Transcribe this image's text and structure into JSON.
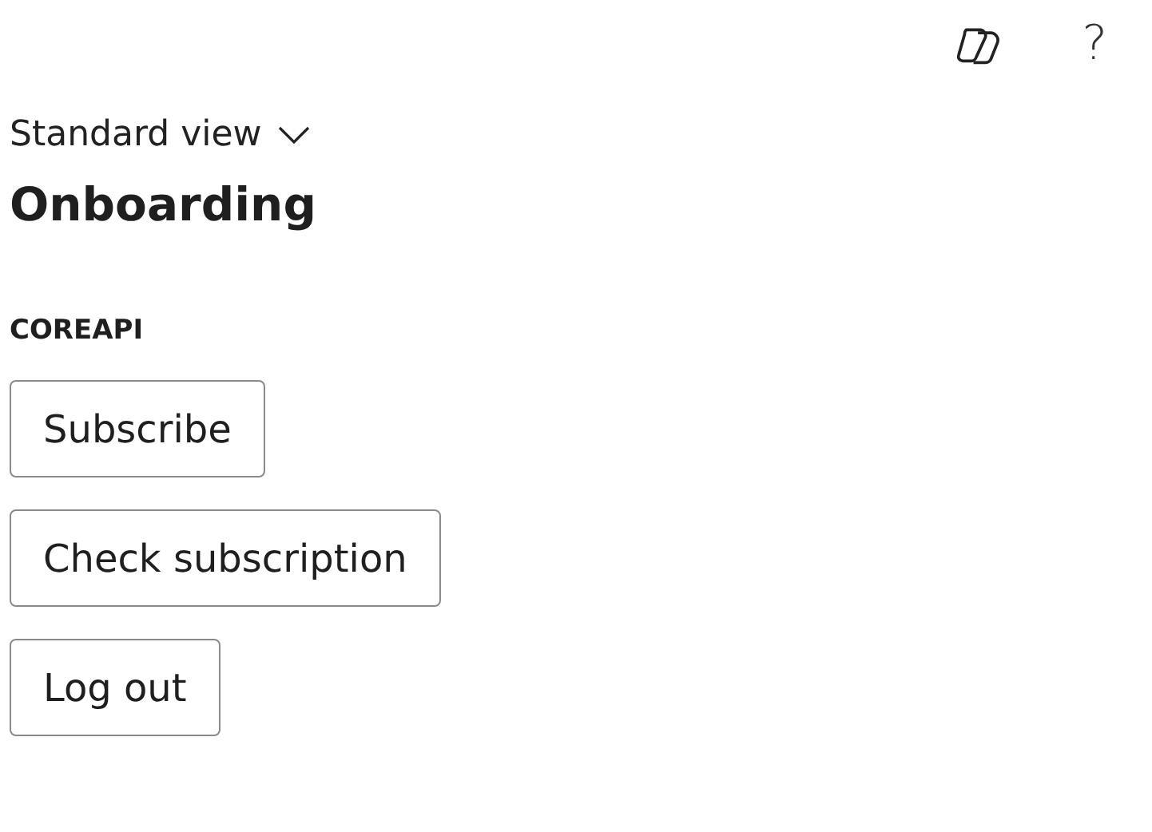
{
  "toolbar": {
    "help": "?"
  },
  "view_menu": {
    "label": "Standard view"
  },
  "title": "Onboarding",
  "section": "COREAPI",
  "buttons": [
    "Subscribe",
    "Check subscription",
    "Log out"
  ]
}
